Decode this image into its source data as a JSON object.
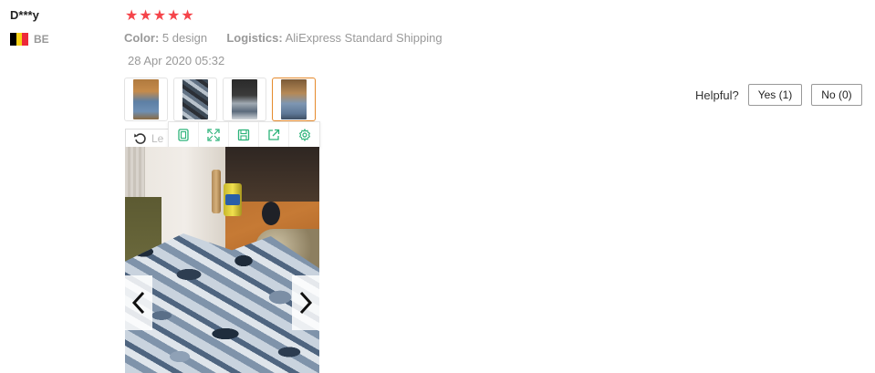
{
  "review": {
    "username": "D***y",
    "country_code": "BE",
    "rating": 5,
    "stars": [
      "★",
      "★",
      "★",
      "★",
      "★"
    ],
    "color_label": "Color:",
    "color_value": "5 design",
    "logistics_label": "Logistics:",
    "logistics_value": "AliExpress Standard Shipping",
    "date": "28 Apr 2020 05:32",
    "helpful_label": "Helpful?",
    "yes_label": "Yes (1)",
    "no_label": "No (0)",
    "rotate_left_label": "Le"
  },
  "colors": {
    "star": "#f5444a",
    "active_thumb_border": "#e58a2c",
    "toolbar_icon": "#2db37a",
    "flag": [
      "#000000",
      "#f7d217",
      "#ed2939"
    ]
  },
  "toolbar": {
    "icons": [
      "fit-window-icon",
      "fullscreen-icon",
      "save-icon",
      "share-icon",
      "settings-icon"
    ]
  },
  "thumbnails": {
    "count": 4,
    "active_index": 3
  }
}
